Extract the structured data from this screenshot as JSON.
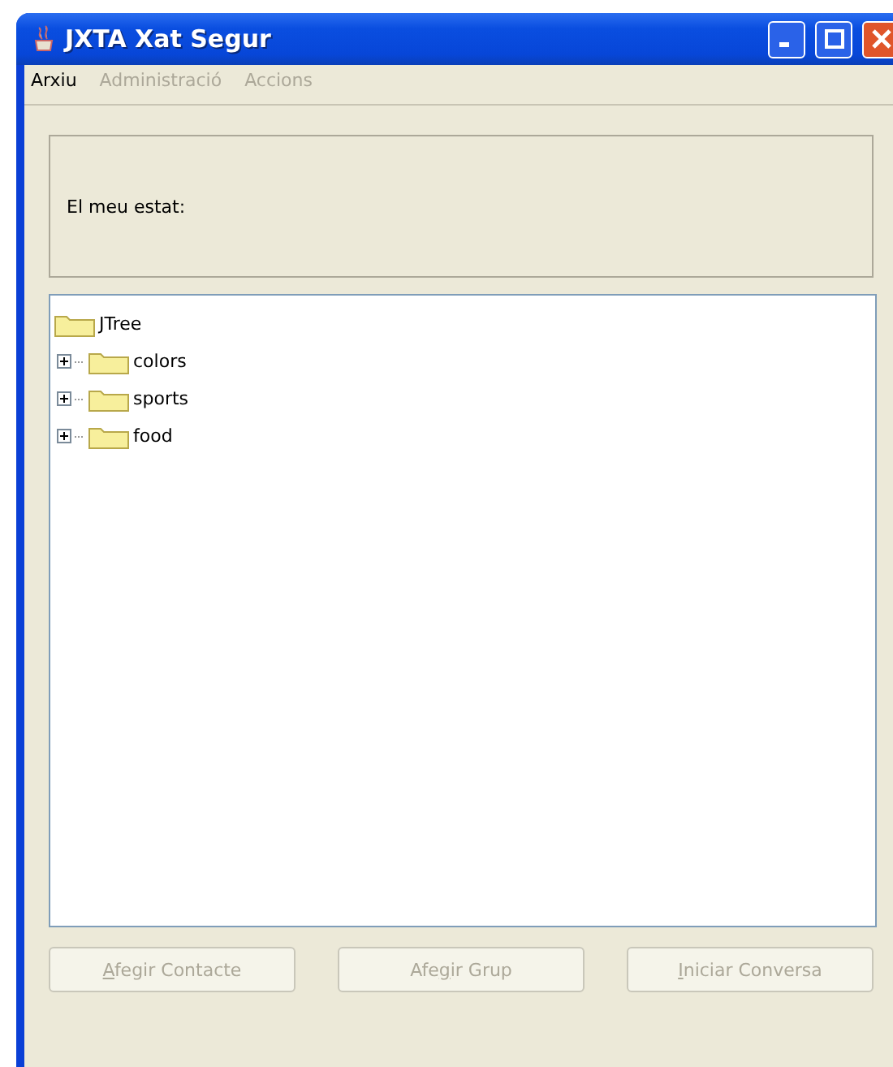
{
  "window": {
    "title": "JXTA Xat Segur"
  },
  "menu": [
    {
      "label": "Arxiu",
      "disabled": false
    },
    {
      "label": "Administració",
      "disabled": true
    },
    {
      "label": "Accions",
      "disabled": true
    }
  ],
  "status_panel": {
    "label": "El meu estat:"
  },
  "tree": {
    "label": "JTree",
    "children": [
      {
        "label": "colors",
        "expanded": false
      },
      {
        "label": "sports",
        "expanded": false
      },
      {
        "label": "food",
        "expanded": false
      }
    ]
  },
  "buttons": [
    {
      "mnemonic": "A",
      "label_after": "fegir Contacte",
      "disabled": true
    },
    {
      "label_before": "Afe",
      "mnemonic": "g",
      "label_after": "ir Grup",
      "disabled": true
    },
    {
      "mnemonic": "I",
      "label_after": "niciar Conversa",
      "disabled": true
    }
  ]
}
